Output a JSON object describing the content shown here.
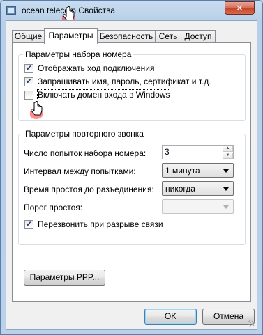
{
  "window": {
    "title": "ocean telecom Свойства",
    "close_label": "✕"
  },
  "tabs": [
    {
      "label": "Общие"
    },
    {
      "label": "Параметры",
      "active": true
    },
    {
      "label": "Безопасность"
    },
    {
      "label": "Сеть"
    },
    {
      "label": "Доступ"
    }
  ],
  "dial_options": {
    "title": "Параметры набора номера",
    "show_progress": {
      "label": "Отображать ход подключения",
      "checked": true
    },
    "prompt_credentials": {
      "label": "Запрашивать имя, пароль, сертификат и т.д.",
      "checked": true
    },
    "include_domain": {
      "label": "Включать домен входа в Windows",
      "checked": false
    }
  },
  "redial_options": {
    "title": "Параметры повторного звонка",
    "attempts_label": "Число попыток набора номера:",
    "attempts_value": "3",
    "interval_label": "Интервал между попытками:",
    "interval_value": "1 минута",
    "idle_label": "Время простоя до разъединения:",
    "idle_value": "никогда",
    "threshold_label": "Порог простоя:",
    "threshold_value": "",
    "redial_on_drop": {
      "label": "Перезвонить при разрыве связи",
      "checked": true
    }
  },
  "ppp_button": "Параметры PPP...",
  "footer": {
    "ok_label": "OK",
    "cancel_label": "Отмена"
  }
}
